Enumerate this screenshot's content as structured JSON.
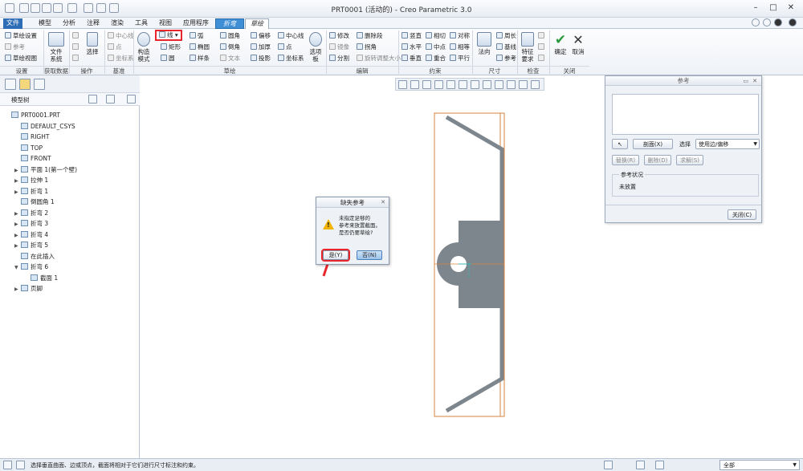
{
  "window": {
    "title": "PRT0001 (活动的) - Creo Parametric 3.0"
  },
  "menu": {
    "tabs": [
      "文件",
      "模型",
      "分析",
      "注释",
      "渲染",
      "工具",
      "视图",
      "应用程序"
    ],
    "context_tabs": [
      "折弯",
      "草绘"
    ]
  },
  "ribbon": {
    "setup": {
      "items": [
        "草绘设置",
        "参考",
        "草绘视图"
      ],
      "label": "设置"
    },
    "get_data": {
      "file_system": "文件\n系统",
      "label": "获取数据"
    },
    "operations": {
      "select": "选择",
      "label": "操作"
    },
    "datum": {
      "items": [
        "中心线",
        "点",
        "坐标系"
      ],
      "label": "基准"
    },
    "sketch": {
      "construction_mode": "构造\n模式",
      "line": "线",
      "items": [
        "弧",
        "圆角",
        "偏移",
        "中心线",
        "矩形",
        "椭圆",
        "倒角",
        "加厚",
        "点",
        "圆",
        "样条",
        "文本",
        "投影",
        "坐标系"
      ],
      "palette": "选项\n板",
      "label": "草绘"
    },
    "editing": {
      "items": [
        "修改",
        "删除段",
        "镜像",
        "拐角",
        "分割",
        "旋转调整大小"
      ],
      "label": "编辑"
    },
    "constrain": {
      "items": [
        "竖直",
        "相切",
        "对称",
        "水平",
        "中点",
        "相等",
        "垂直",
        "重合",
        "平行"
      ],
      "label": "约束"
    },
    "dimension": {
      "normal": "法向",
      "items": [
        "周长",
        "基线",
        "参考"
      ],
      "label": "尺寸"
    },
    "inspect": {
      "feature_req": "特征\n要求",
      "label": "检查"
    },
    "close": {
      "ok": "确定",
      "cancel": "取消",
      "label": "关闭"
    }
  },
  "model_tree": {
    "header": "模型树",
    "items": [
      {
        "label": "PRT0001.PRT",
        "indent": 0,
        "expand": ""
      },
      {
        "label": "DEFAULT_CSYS",
        "indent": 1,
        "expand": ""
      },
      {
        "label": "RIGHT",
        "indent": 1,
        "expand": ""
      },
      {
        "label": "TOP",
        "indent": 1,
        "expand": ""
      },
      {
        "label": "FRONT",
        "indent": 1,
        "expand": ""
      },
      {
        "label": "平面 1(第一个壁)",
        "indent": 1,
        "expand": "▶"
      },
      {
        "label": "拉伸 1",
        "indent": 1,
        "expand": "▶"
      },
      {
        "label": "折弯 1",
        "indent": 1,
        "expand": "▶"
      },
      {
        "label": "倒圆角 1",
        "indent": 1,
        "expand": ""
      },
      {
        "label": "折弯 2",
        "indent": 1,
        "expand": "▶"
      },
      {
        "label": "折弯 3",
        "indent": 1,
        "expand": "▶"
      },
      {
        "label": "折弯 4",
        "indent": 1,
        "expand": "▶"
      },
      {
        "label": "折弯 5",
        "indent": 1,
        "expand": "▶"
      },
      {
        "label": "在此插入",
        "indent": 1,
        "expand": ""
      },
      {
        "label": "折弯 6",
        "indent": 1,
        "expand": "▼"
      },
      {
        "label": "截面 1",
        "indent": 2,
        "expand": ""
      },
      {
        "label": "页脚",
        "indent": 1,
        "expand": "▶"
      }
    ]
  },
  "dialog": {
    "title": "缺失参考",
    "message_line1": "未指定足够的",
    "message_line2": "参考来放置截面。",
    "message_line3": "是否仍要草绘?",
    "yes": "是(Y)",
    "no": "否(N)"
  },
  "references": {
    "title": "参考",
    "select_button": "剖面(X)",
    "select_label": "选择",
    "select_value": "使用边/偏移",
    "replace": "替换(R)",
    "delete": "删除(D)",
    "solve": "求解(S)",
    "status_header": "参考状况",
    "status_value": "未放置",
    "close": "关闭(C)"
  },
  "status": {
    "message": "选择垂直曲面、边或顶点，截面将相对于它们进行尺寸标注和约束。",
    "filter": "全部"
  },
  "colors": {
    "accent": "#3f8fd6",
    "highlight": "#e8262b",
    "part": "#7d858d",
    "sketch_frame": "#d9843e"
  }
}
